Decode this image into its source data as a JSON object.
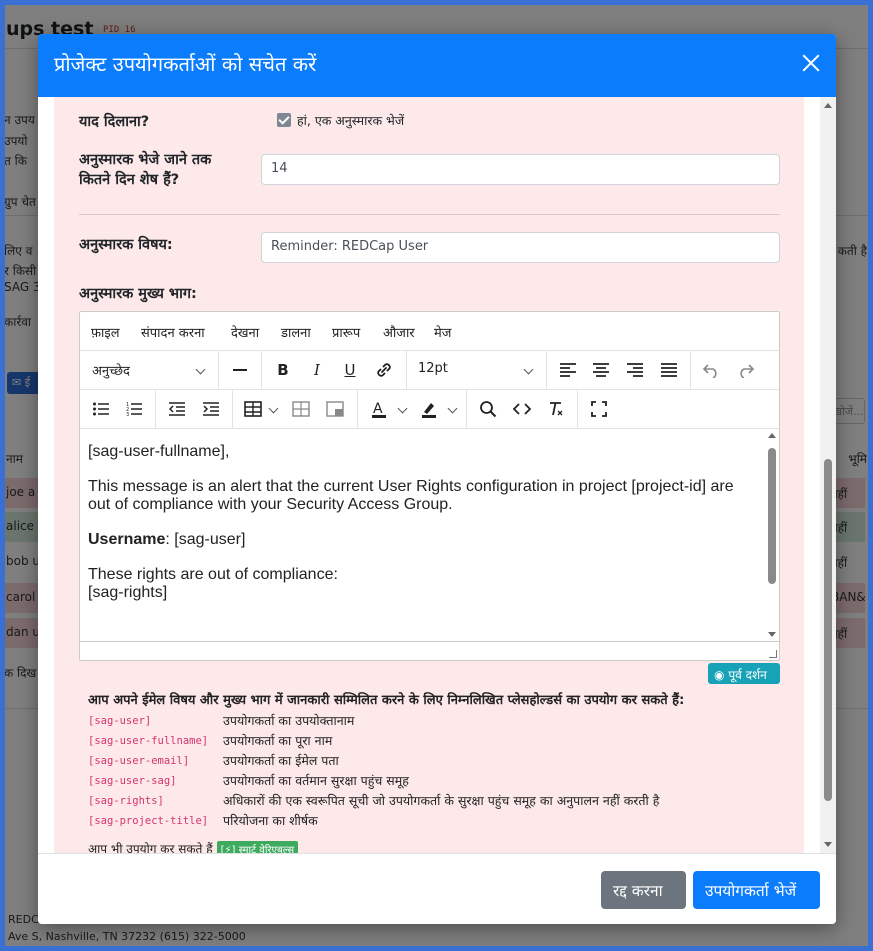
{
  "background": {
    "title": "ups test",
    "pid": "PID 16",
    "left_texts": [
      "न उपय",
      "उपयो",
      "त कि",
      "ग्रुप चेत",
      "लिए व",
      "र किसी",
      "SAG 3",
      "कार्रवा"
    ],
    "email_button": "ई",
    "table_header_left": "नाम",
    "table_header_right": "भूमि",
    "search_placeholder": "खोजें...",
    "rows_left": [
      "joe a",
      "alice",
      "bob u",
      "carol",
      "dan u"
    ],
    "rows_right": [
      "नहीं",
      "नहीं",
      "नहीं",
      "BAN&",
      "नहीं"
    ],
    "right_text": "कती है",
    "below_table": "क दिख",
    "footer_line1": "REDC",
    "footer_line2": "Ave S, Nashville, TN 37232 (615) 322-5000"
  },
  "modal": {
    "title": "प्रोजेक्ट उपयोगकर्ताओं को सचेत करें",
    "reminder_label": "याद दिलाना?",
    "reminder_checked": true,
    "reminder_checkbox_label": "हां, एक अनुस्मारक भेजें",
    "days_label": "अनुस्मारक भेजे जाने तक कितने दिन शेष हैं?",
    "days_value": "14",
    "subject_label": "अनुस्मारक विषय:",
    "subject_value": "Reminder: REDCap User",
    "body_label": "अनुस्मारक मुख्य भाग:",
    "editor": {
      "menus": [
        "फ़ाइल",
        "संपादन करना",
        "देखना",
        "डालना",
        "प्रारूप",
        "औजार",
        "मेज"
      ],
      "paragraph_select": "अनुच्छेद",
      "font_size": "12pt",
      "content": {
        "line1": "[sag-user-fullname],",
        "line2": "This message is an alert that the current User Rights configuration in project [project-id] are out of compliance with your Security Access Group.",
        "username_label": "Username",
        "username_value": ": [sag-user]",
        "line4": "These rights are out of compliance:",
        "line5": "[sag-rights]"
      }
    },
    "preview_button": "पूर्व दर्शन",
    "placeholders_intro": "आप अपने ईमेल विषय और मुख्य भाग में जानकारी सम्मिलित करने के लिए निम्नलिखित प्लेसहोल्डर्स का उपयोग कर सकते हैं:",
    "placeholders": [
      {
        "code": "[sag-user]",
        "desc": "उपयोगकर्ता का उपयोक्तानाम"
      },
      {
        "code": "[sag-user-fullname]",
        "desc": "उपयोगकर्ता का पूरा नाम"
      },
      {
        "code": "[sag-user-email]",
        "desc": "उपयोगकर्ता का ईमेल पता"
      },
      {
        "code": "[sag-user-sag]",
        "desc": "उपयोगकर्ता का वर्तमान सुरक्षा पहुंच समूह"
      },
      {
        "code": "[sag-rights]",
        "desc": "अधिकारों की एक स्वरूपित सूची जो उपयोगकर्ता के सुरक्षा पहुंच समूह का अनुपालन नहीं करती है"
      },
      {
        "code": "[sag-project-title]",
        "desc": "परियोजना का शीर्षक"
      }
    ],
    "smart_line": "आप भी उपयोग कर सकते हैं",
    "smart_badge": "[⚡] स्मार्ट वेरिएबल्स",
    "cancel_button": "रद्द करना",
    "send_button": "उपयोगकर्ता भेजें"
  },
  "colors": {
    "header": "#0b7dfc",
    "body_tint": "#fde9ea",
    "cancel": "#6c757d",
    "send": "#0b7dfc",
    "preview": "#17a2b8",
    "placeholder_code": "#d6336c"
  }
}
